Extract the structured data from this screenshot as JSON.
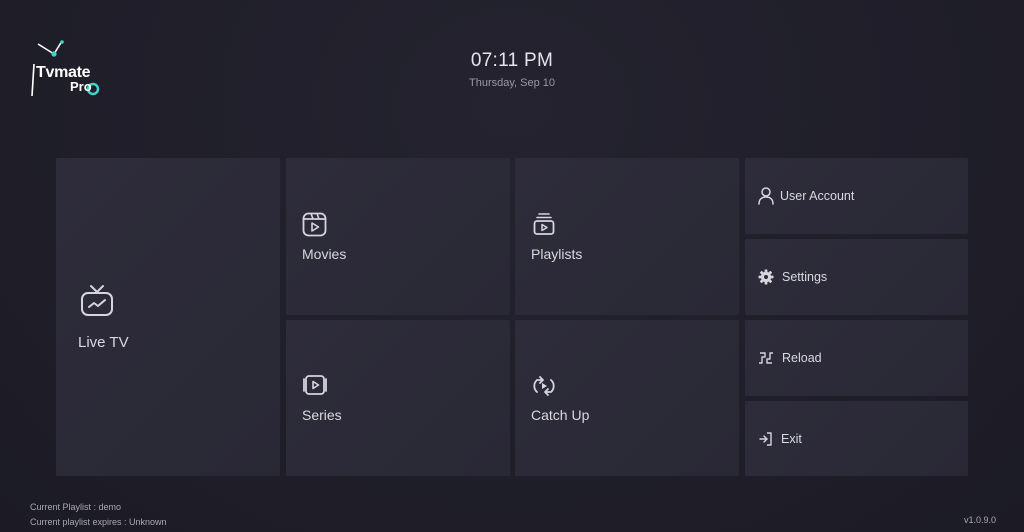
{
  "header": {
    "logo_text": "Tvmate",
    "logo_sub": "Pro",
    "time": "07:11 PM",
    "date": "Thursday, Sep 10"
  },
  "tiles": {
    "live_tv": "Live TV",
    "movies": "Movies",
    "series": "Series",
    "playlists": "Playlists",
    "catch_up": "Catch Up"
  },
  "side_menu": {
    "user_account": "User Account",
    "settings": "Settings",
    "reload": "Reload",
    "exit": "Exit"
  },
  "footer": {
    "current_playlist": "Current Playlist : demo",
    "playlist_expires": "Current playlist expires : Unknown",
    "version": "v1.0.9.0"
  },
  "colors": {
    "background": "#1f1e2a",
    "tile": "#2b2a37",
    "accent": "#3fd6c9"
  },
  "icons": {
    "live_tv": "tv-icon",
    "movies": "film-icon",
    "series": "series-icon",
    "playlists": "playlist-icon",
    "catch_up": "catchup-icon",
    "user_account": "user-icon",
    "settings": "gear-icon",
    "reload": "reload-icon",
    "exit": "exit-icon"
  }
}
